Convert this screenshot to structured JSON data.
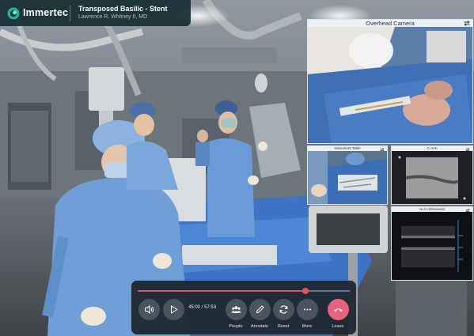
{
  "header": {
    "brand": "Immertec",
    "procedure_title": "Transposed Basilic - Stent",
    "surgeon": "Lawrence R. Whitney II, MD"
  },
  "panels": {
    "overhead": {
      "title": "Overhead Camera"
    },
    "instrument": {
      "title": "Instrument Table"
    },
    "carm": {
      "title": "C-Arm"
    },
    "ultrasound": {
      "title": "ULS Ultrasound"
    }
  },
  "player": {
    "progress": 0.79,
    "time_display": "45:00 / 57:53",
    "buttons": {
      "people": "People",
      "annotate": "Annotate",
      "reset": "Reset",
      "more": "More",
      "leave": "Leave"
    }
  },
  "colors": {
    "accent": "#e2526b",
    "leave": "#e8627d",
    "scrubs": "#6f9fd6",
    "drape": "#3f73c6"
  }
}
